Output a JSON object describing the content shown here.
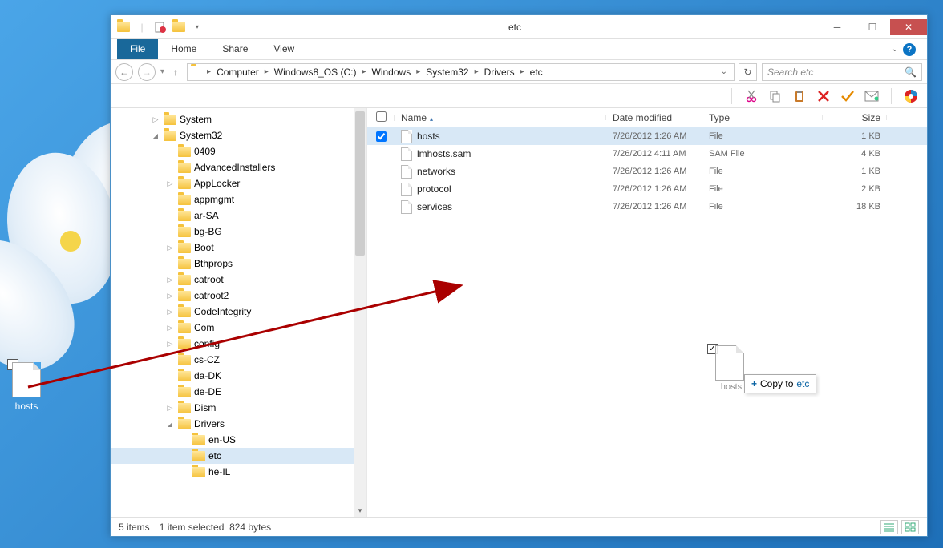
{
  "desktop_file": {
    "name": "hosts"
  },
  "window": {
    "title": "etc",
    "tabs": {
      "file": "File",
      "home": "Home",
      "share": "Share",
      "view": "View"
    },
    "breadcrumb": [
      "Computer",
      "Windows8_OS (C:)",
      "Windows",
      "System32",
      "Drivers",
      "etc"
    ],
    "search_placeholder": "Search etc"
  },
  "tree": {
    "items": [
      {
        "indent": 50,
        "arrow": "closed",
        "label": "System"
      },
      {
        "indent": 50,
        "arrow": "open",
        "label": "System32"
      },
      {
        "indent": 68,
        "arrow": "none",
        "label": "0409"
      },
      {
        "indent": 68,
        "arrow": "none",
        "label": "AdvancedInstallers"
      },
      {
        "indent": 68,
        "arrow": "closed",
        "label": "AppLocker"
      },
      {
        "indent": 68,
        "arrow": "none",
        "label": "appmgmt"
      },
      {
        "indent": 68,
        "arrow": "none",
        "label": "ar-SA"
      },
      {
        "indent": 68,
        "arrow": "none",
        "label": "bg-BG"
      },
      {
        "indent": 68,
        "arrow": "closed",
        "label": "Boot"
      },
      {
        "indent": 68,
        "arrow": "none",
        "label": "Bthprops"
      },
      {
        "indent": 68,
        "arrow": "closed",
        "label": "catroot"
      },
      {
        "indent": 68,
        "arrow": "closed",
        "label": "catroot2"
      },
      {
        "indent": 68,
        "arrow": "closed",
        "label": "CodeIntegrity"
      },
      {
        "indent": 68,
        "arrow": "closed",
        "label": "Com"
      },
      {
        "indent": 68,
        "arrow": "closed",
        "label": "config"
      },
      {
        "indent": 68,
        "arrow": "none",
        "label": "cs-CZ"
      },
      {
        "indent": 68,
        "arrow": "none",
        "label": "da-DK"
      },
      {
        "indent": 68,
        "arrow": "none",
        "label": "de-DE"
      },
      {
        "indent": 68,
        "arrow": "closed",
        "label": "Dism"
      },
      {
        "indent": 68,
        "arrow": "open",
        "label": "Drivers"
      },
      {
        "indent": 86,
        "arrow": "none",
        "label": "en-US"
      },
      {
        "indent": 86,
        "arrow": "none",
        "label": "etc",
        "selected": true
      },
      {
        "indent": 86,
        "arrow": "none",
        "label": "he-IL"
      }
    ]
  },
  "columns": {
    "name": "Name",
    "date": "Date modified",
    "type": "Type",
    "size": "Size"
  },
  "files": [
    {
      "checked": true,
      "name": "hosts",
      "date": "7/26/2012 1:26 AM",
      "type": "File",
      "size": "1 KB",
      "selected": true
    },
    {
      "checked": false,
      "name": "lmhosts.sam",
      "date": "7/26/2012 4:11 AM",
      "type": "SAM File",
      "size": "4 KB"
    },
    {
      "checked": false,
      "name": "networks",
      "date": "7/26/2012 1:26 AM",
      "type": "File",
      "size": "1 KB"
    },
    {
      "checked": false,
      "name": "protocol",
      "date": "7/26/2012 1:26 AM",
      "type": "File",
      "size": "2 KB"
    },
    {
      "checked": false,
      "name": "services",
      "date": "7/26/2012 1:26 AM",
      "type": "File",
      "size": "18 KB"
    }
  ],
  "drag": {
    "file_label": "hosts",
    "tip_prefix": "Copy to",
    "tip_dest": "etc"
  },
  "status": {
    "count": "5 items",
    "selected": "1 item selected",
    "bytes": "824 bytes"
  }
}
